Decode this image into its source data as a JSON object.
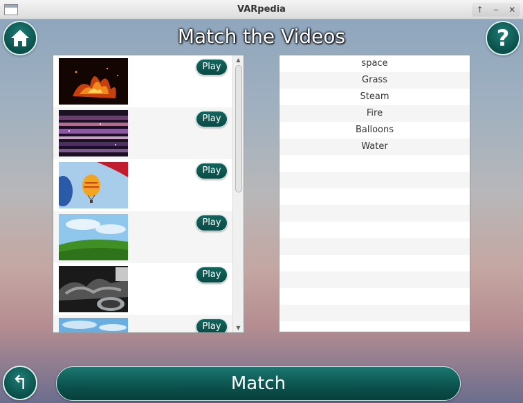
{
  "window": {
    "title": "VARpedia",
    "controls": [
      "↑",
      "‒",
      "✕"
    ]
  },
  "header": {
    "title": "Match the Videos",
    "home_icon": "home-icon",
    "help_icon": "help-icon",
    "help_glyph": "?"
  },
  "videos": {
    "play_label": "Play",
    "items": [
      {
        "thumbnail": "fire"
      },
      {
        "thumbnail": "space"
      },
      {
        "thumbnail": "balloons"
      },
      {
        "thumbnail": "grass"
      },
      {
        "thumbnail": "steam"
      },
      {
        "thumbnail": "water"
      }
    ]
  },
  "names": {
    "items": [
      "space",
      "Grass",
      "Steam",
      "Fire",
      "Balloons",
      "Water"
    ],
    "empty_rows": 11
  },
  "footer": {
    "back_icon": "back-arrow-icon",
    "back_glyph": "↰",
    "match_label": "Match"
  },
  "colors": {
    "accent": "#0b514c",
    "accent_light": "#1b7770"
  }
}
